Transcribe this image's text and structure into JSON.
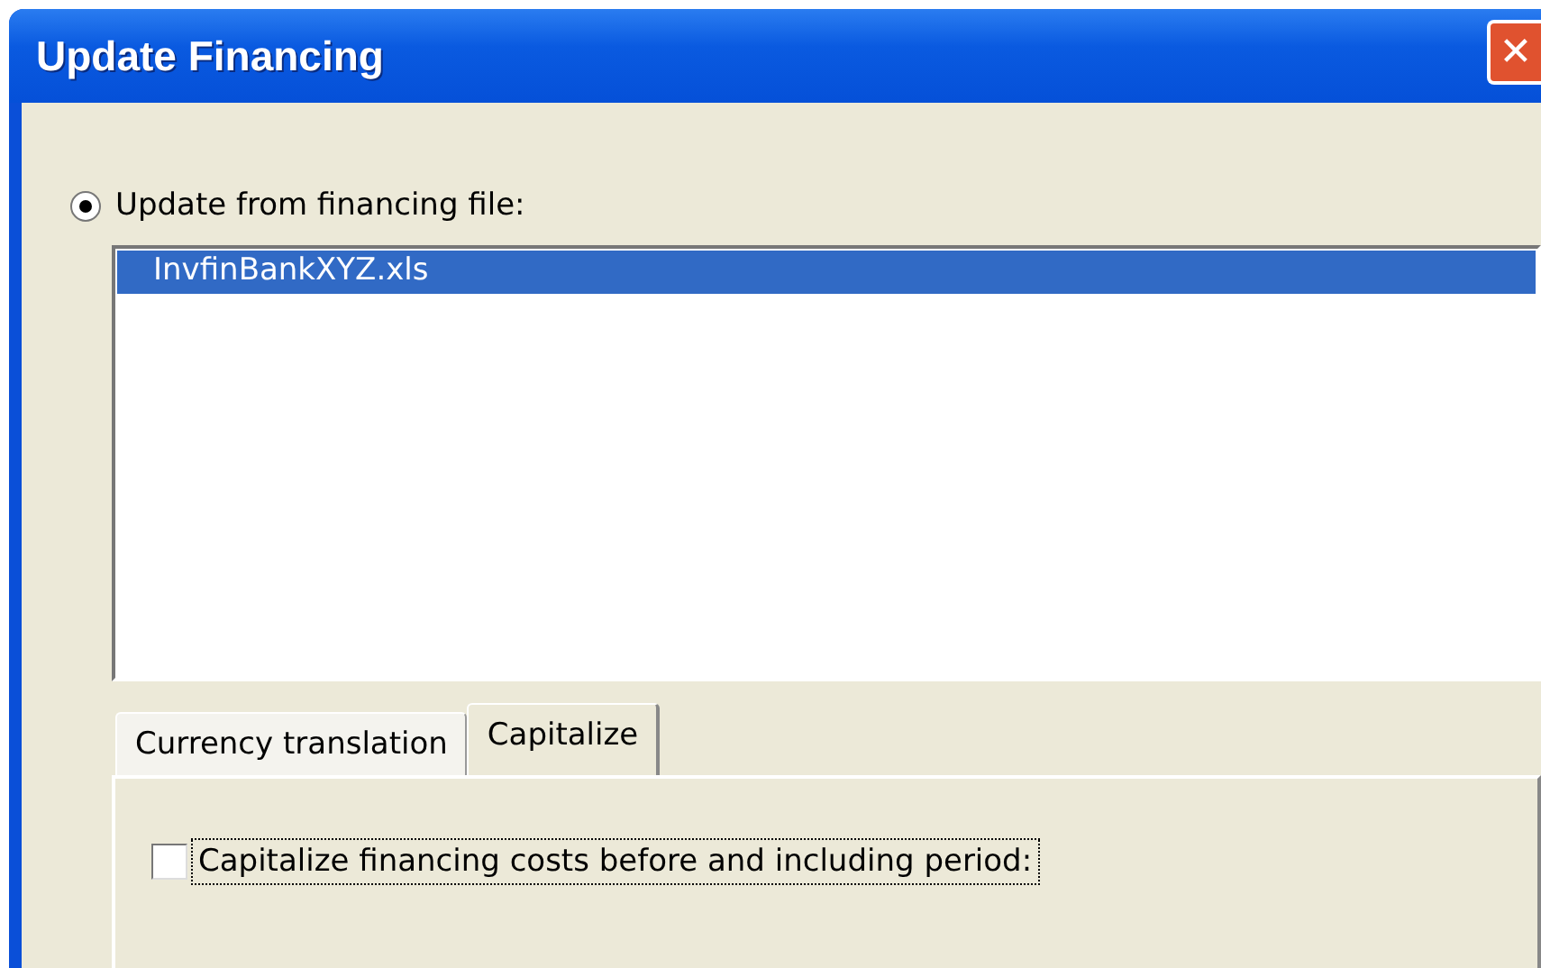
{
  "window": {
    "title": "Update Financing",
    "close_symbol": "✕"
  },
  "source_option": {
    "label": "Update from financing file:",
    "selected": true
  },
  "file_list": [
    {
      "label": "InvfinBankXYZ.xls",
      "selected": true
    }
  ],
  "tabs": [
    {
      "label": "Currency translation",
      "selected": false
    },
    {
      "label": "Capitalize",
      "selected": true
    }
  ],
  "capitalize_checkbox": {
    "label": "Capitalize financing costs before and including period:",
    "checked": false,
    "focused": true
  }
}
